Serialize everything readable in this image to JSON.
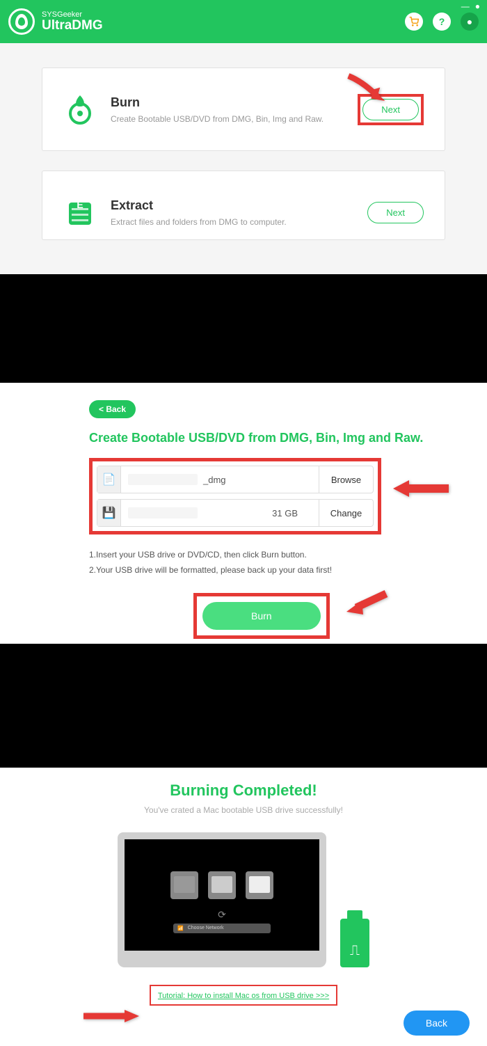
{
  "header": {
    "brand_sub": "SYSGeeker",
    "brand_main": "UltraDMG"
  },
  "cards": {
    "burn": {
      "title": "Burn",
      "desc": "Create Bootable USB/DVD from DMG, Bin, Img and Raw.",
      "button": "Next"
    },
    "extract": {
      "title": "Extract",
      "desc": "Extract files and folders from DMG to computer.",
      "button": "Next"
    }
  },
  "burn_screen": {
    "back": "< Back",
    "heading": "Create Bootable USB/DVD from DMG, Bin, Img and Raw.",
    "file_suffix": "_dmg",
    "browse": "Browse",
    "drive_size": "31 GB",
    "change": "Change",
    "inst1": "1.Insert your USB drive or DVD/CD, then click Burn button.",
    "inst2": "2.Your USB drive will be formatted, please back up your data first!",
    "burn_btn": "Burn"
  },
  "complete": {
    "title": "Burning Completed!",
    "subtitle": "You've crated a Mac bootable USB drive successfully!",
    "boot_bar": "Choose Network",
    "tutorial": "Tutorial: How to install Mac os from USB drive >>>",
    "back": "Back"
  }
}
